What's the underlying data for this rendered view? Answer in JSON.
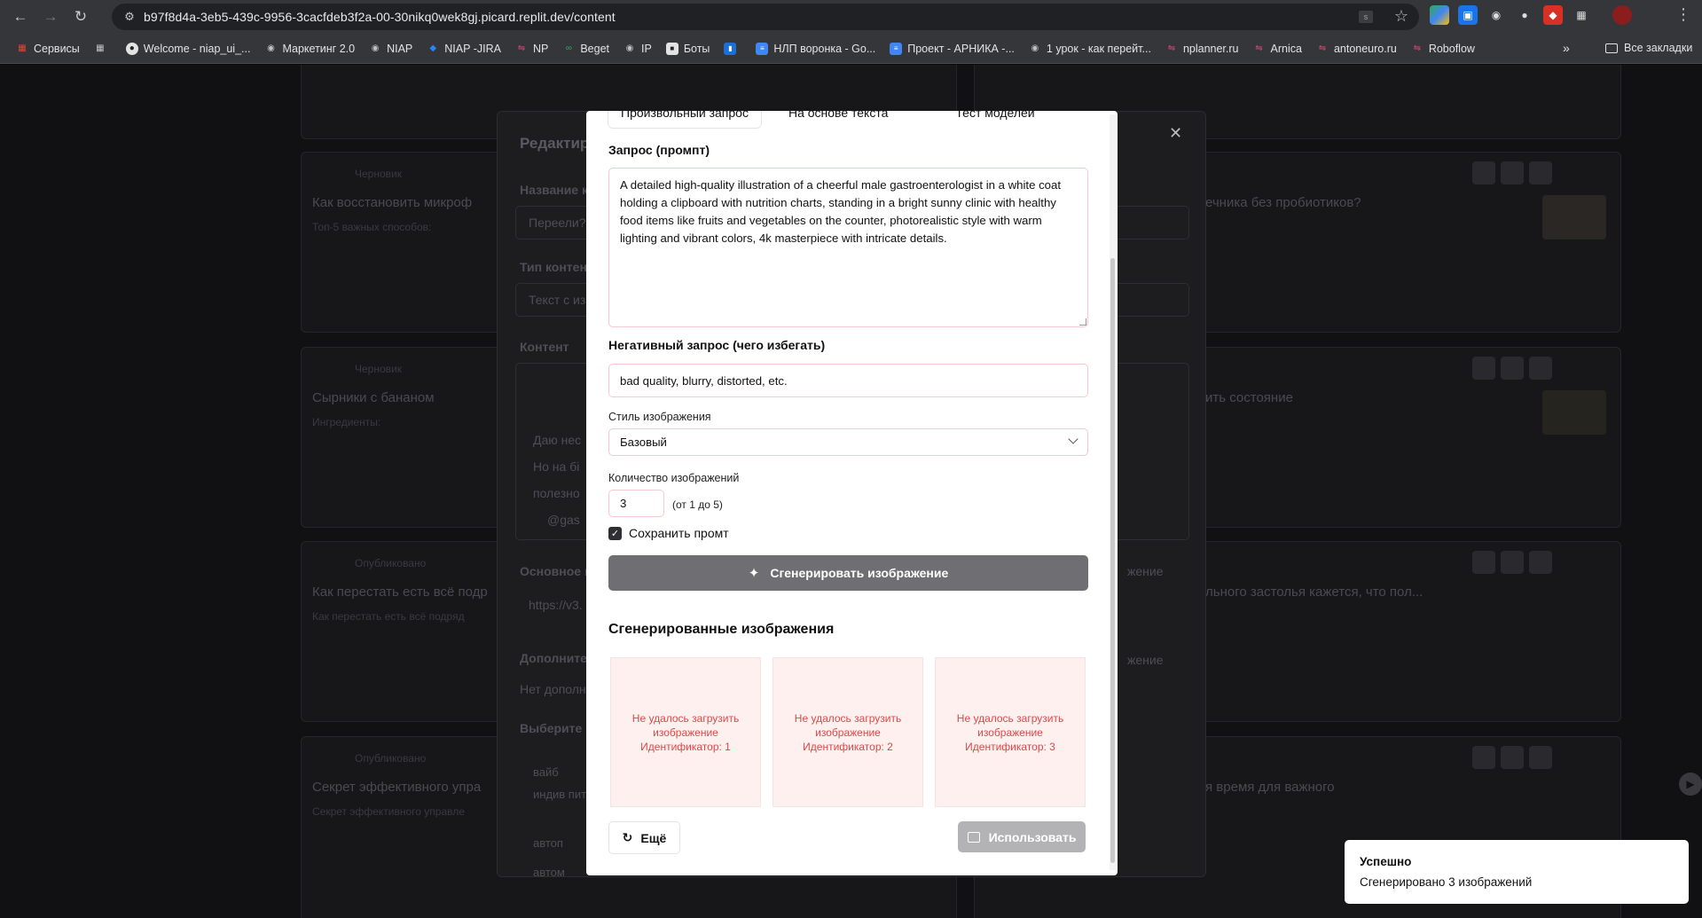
{
  "browser": {
    "url": "b97f8d4a-3eb5-439c-9956-3cacfdeb3f2a-00-30nikq0wek8gj.picard.replit.dev/content",
    "ext_badge": "s",
    "bookmarks": [
      {
        "label": "Сервисы",
        "icon": "apps-grid-icon",
        "color": "#e94235"
      },
      {
        "label": "",
        "icon": "tab-groups-icon",
        "color": "#5f6368"
      },
      {
        "label": "Welcome - niap_ui_...",
        "icon": "github-icon",
        "color": "#e3e3e3"
      },
      {
        "label": "Маркетинг 2.0",
        "icon": "globe-icon",
        "color": "#9aa0a6"
      },
      {
        "label": "NIAP",
        "icon": "globe-icon",
        "color": "#9aa0a6"
      },
      {
        "label": "NIAP -JIRA",
        "icon": "jira-icon",
        "color": "#2684ff"
      },
      {
        "label": "NP",
        "icon": "tab-icon",
        "color": "#e94b6b"
      },
      {
        "label": "Beget",
        "icon": "beget-icon",
        "color": "#34a853"
      },
      {
        "label": "IP",
        "icon": "globe-icon",
        "color": "#9aa0a6"
      },
      {
        "label": "Боты",
        "icon": "bots-icon",
        "color": "#e3e3e3"
      },
      {
        "label": "",
        "icon": "trello-icon",
        "color": "#1d6fd6"
      },
      {
        "label": "НЛП воронка - Go...",
        "icon": "docs-icon",
        "color": "#4285f4"
      },
      {
        "label": "Проект - АРНИКА -...",
        "icon": "docs-icon",
        "color": "#4285f4"
      },
      {
        "label": "1 урок - как перейт...",
        "icon": "globe-icon",
        "color": "#9aa0a6"
      },
      {
        "label": "nplanner.ru",
        "icon": "tab-icon",
        "color": "#e94b6b"
      },
      {
        "label": "Arnica",
        "icon": "tab-icon",
        "color": "#e94b6b"
      },
      {
        "label": "antoneuro.ru",
        "icon": "tab-icon",
        "color": "#e94b6b"
      },
      {
        "label": "Roboflow",
        "icon": "tab-icon",
        "color": "#e94b6b"
      }
    ],
    "all_bookmarks": "Все закладки"
  },
  "background": {
    "cards_left": [
      {
        "title": "Как восстановить микроф",
        "badge": "Черновик",
        "text": "Топ-5 важных способов:"
      },
      {
        "title": "Сырники с бананом",
        "badge": "Черновик",
        "text": "Ингредиенты:"
      },
      {
        "title": "Как перестать есть всё подр",
        "badge": "Опубликовано",
        "text": "Как перестать есть всё подряд"
      },
      {
        "title": "Секрет эффективного упра",
        "badge": "Опубликовано",
        "text": "Секрет эффективного управле"
      }
    ],
    "cards_right": [
      {
        "title": "ечника без пробиотиков?"
      },
      {
        "title": "ить состояние"
      },
      {
        "title": "льного застолья кажется, что пол..."
      },
      {
        "title": "я время для важного"
      }
    ],
    "editor": {
      "title": "Редактир",
      "name_label": "Название к",
      "name_value": "Переели?",
      "type_label": "Тип контент",
      "type_value": "Текст с из",
      "content_label": "Контент",
      "content_lines": [
        "Даю нес",
        "Но на бі",
        "полезно",
        "@gas"
      ],
      "image_label": "Основное и",
      "image_value": "https://v3.",
      "extra_label": "Дополните",
      "extra_value": "Нет дополн",
      "choose_label": "Выберите к",
      "checks": [
        "вайб",
        "индив питани",
        "автоп",
        "автом"
      ],
      "right_btn": "жение"
    }
  },
  "modal": {
    "tabs": [
      "Произвольный запрос",
      "На основе текста",
      "Тест моделей"
    ],
    "prompt_label": "Запрос (промпт)",
    "prompt_value": "A detailed high-quality illustration of a cheerful male gastroenterologist in a white coat holding a clipboard with nutrition charts, standing in a bright sunny clinic with healthy food items like fruits and vegetables on the counter, photorealistic style with warm lighting and vibrant colors, 4k masterpiece with intricate details.",
    "negative_label": "Негативный запрос (чего избегать)",
    "negative_value": "bad quality, blurry, distorted, etc.",
    "style_label": "Стиль изображения",
    "style_value": "Базовый",
    "count_label": "Количество изображений",
    "count_value": "3",
    "count_hint": "(от 1 до 5)",
    "save_prompt_label": "Сохранить промт",
    "generate_label": "Сгенерировать изображение",
    "generated_title": "Сгенерированные изображения",
    "images": [
      {
        "line1": "Не удалось загрузить",
        "line2": "изображение",
        "line3": "Идентификатор: 1"
      },
      {
        "line1": "Не удалось загрузить",
        "line2": "изображение",
        "line3": "Идентификатор: 2"
      },
      {
        "line1": "Не удалось загрузить",
        "line2": "изображение",
        "line3": "Идентификатор: 3"
      }
    ],
    "more_label": "Ещё",
    "use_label": "Использовать"
  },
  "toast": {
    "title": "Успешно",
    "message": "Сгенерировано 3 изображений"
  }
}
